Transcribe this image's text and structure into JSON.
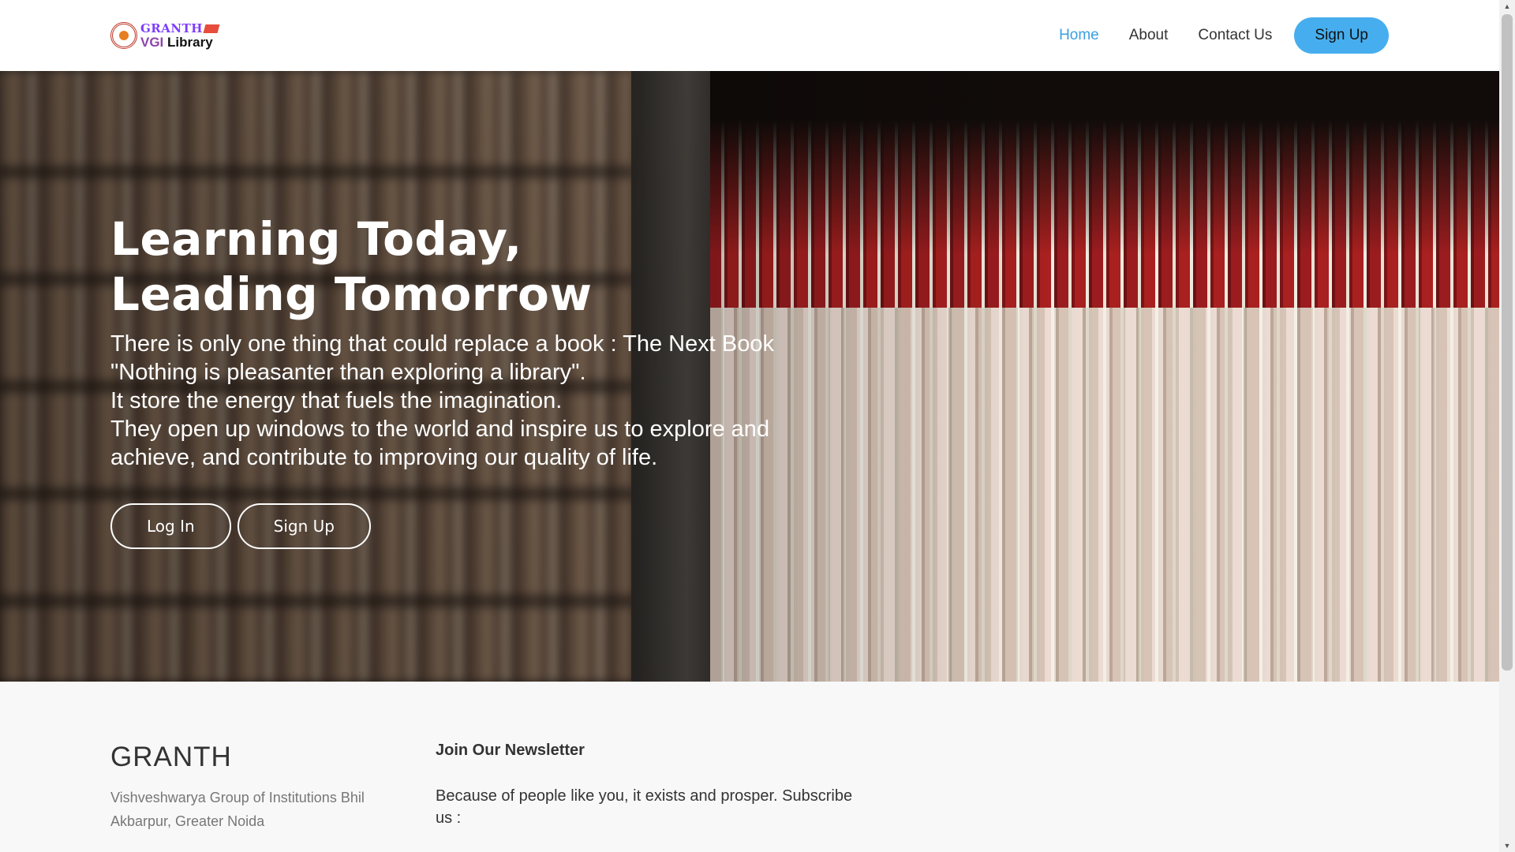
{
  "header": {
    "logo": {
      "line1": "GRANTH",
      "line2_vgi": "VGI",
      "line2_library": "Library"
    },
    "nav": [
      {
        "label": "Home",
        "active": true
      },
      {
        "label": "About",
        "active": false
      },
      {
        "label": "Contact Us",
        "active": false
      }
    ],
    "signup_label": "Sign Up"
  },
  "hero": {
    "title_line1": "Learning Today,",
    "title_line2": "Leading Tomorrow",
    "lines": [
      "There is only one thing that could replace a book : The Next Book",
      "\"Nothing is pleasanter than exploring a library\".",
      "It store the energy that fuels the imagination.",
      "They open up windows to the world and inspire us to explore and achieve, and contribute to improving our quality of life."
    ],
    "login_label": "Log In",
    "signup_label": "Sign Up"
  },
  "footer": {
    "brand": "GRANTH",
    "address": "Vishveshwarya Group of Institutions Bhil Akbarpur, Greater Noida",
    "newsletter_title": "Join Our Newsletter",
    "newsletter_text": "Because of people like you, it exists and prosper. Subscribe us :"
  },
  "colors": {
    "accent": "#46aeee",
    "nav_active": "#3aa0e0",
    "footer_bg": "#f8f8f8"
  },
  "icons": {
    "scroll_up": "chevron-up-icon",
    "scroll_down": "chevron-down-icon"
  }
}
